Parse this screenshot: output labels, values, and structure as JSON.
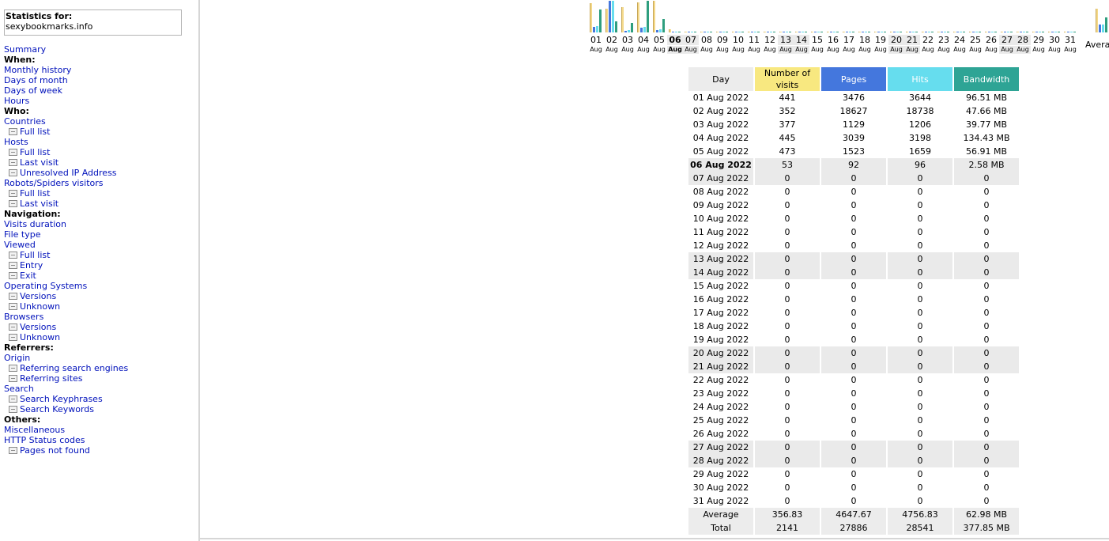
{
  "sidebar": {
    "stats_label": "Statistics for:",
    "site": "sexybookmarks.info",
    "items": [
      {
        "type": "link",
        "label": "Summary"
      },
      {
        "type": "head",
        "label": "When:"
      },
      {
        "type": "link",
        "label": "Monthly history"
      },
      {
        "type": "link",
        "label": "Days of month"
      },
      {
        "type": "link",
        "label": "Days of week"
      },
      {
        "type": "link",
        "label": "Hours"
      },
      {
        "type": "head",
        "label": "Who:"
      },
      {
        "type": "link",
        "label": "Countries"
      },
      {
        "type": "sub",
        "label": "Full list"
      },
      {
        "type": "link",
        "label": "Hosts"
      },
      {
        "type": "sub",
        "label": "Full list"
      },
      {
        "type": "sub",
        "label": "Last visit"
      },
      {
        "type": "sub",
        "label": "Unresolved IP Address"
      },
      {
        "type": "link",
        "label": "Robots/Spiders visitors"
      },
      {
        "type": "sub",
        "label": "Full list"
      },
      {
        "type": "sub",
        "label": "Last visit"
      },
      {
        "type": "head",
        "label": "Navigation:"
      },
      {
        "type": "link",
        "label": "Visits duration"
      },
      {
        "type": "link",
        "label": "File type"
      },
      {
        "type": "link",
        "label": "Viewed"
      },
      {
        "type": "sub",
        "label": "Full list"
      },
      {
        "type": "sub",
        "label": "Entry"
      },
      {
        "type": "sub",
        "label": "Exit"
      },
      {
        "type": "link",
        "label": "Operating Systems"
      },
      {
        "type": "sub",
        "label": "Versions"
      },
      {
        "type": "sub",
        "label": "Unknown"
      },
      {
        "type": "link",
        "label": "Browsers"
      },
      {
        "type": "sub",
        "label": "Versions"
      },
      {
        "type": "sub",
        "label": "Unknown"
      },
      {
        "type": "head",
        "label": "Referrers:"
      },
      {
        "type": "link",
        "label": "Origin"
      },
      {
        "type": "sub",
        "label": "Referring search engines"
      },
      {
        "type": "sub",
        "label": "Referring sites"
      },
      {
        "type": "link",
        "label": "Search"
      },
      {
        "type": "sub",
        "label": "Search Keyphrases"
      },
      {
        "type": "sub",
        "label": "Search Keywords"
      },
      {
        "type": "head",
        "label": "Others:"
      },
      {
        "type": "link",
        "label": "Miscellaneous"
      },
      {
        "type": "link",
        "label": "HTTP Status codes"
      },
      {
        "type": "sub",
        "label": "Pages not found"
      }
    ]
  },
  "colors": {
    "visits": "#f8e880",
    "pages": "#4477dd",
    "hits": "#66ddee",
    "bandwidth": "#2ea495",
    "link": "#0011bb"
  },
  "chart_data": {
    "type": "bar",
    "categories": [
      "01",
      "02",
      "03",
      "04",
      "05",
      "06",
      "07",
      "08",
      "09",
      "10",
      "11",
      "12",
      "13",
      "14",
      "15",
      "16",
      "17",
      "18",
      "19",
      "20",
      "21",
      "22",
      "23",
      "24",
      "25",
      "26",
      "27",
      "28",
      "29",
      "30",
      "31"
    ],
    "month_label": "Aug",
    "average_label": "Average",
    "series": [
      {
        "name": "Number of visits",
        "values": [
          441,
          352,
          377,
          445,
          473,
          53,
          0,
          0,
          0,
          0,
          0,
          0,
          0,
          0,
          0,
          0,
          0,
          0,
          0,
          0,
          0,
          0,
          0,
          0,
          0,
          0,
          0,
          0,
          0,
          0,
          0
        ]
      },
      {
        "name": "Pages",
        "values": [
          3476,
          18627,
          1129,
          3039,
          1523,
          92,
          0,
          0,
          0,
          0,
          0,
          0,
          0,
          0,
          0,
          0,
          0,
          0,
          0,
          0,
          0,
          0,
          0,
          0,
          0,
          0,
          0,
          0,
          0,
          0,
          0
        ]
      },
      {
        "name": "Hits",
        "values": [
          3644,
          18738,
          1206,
          3198,
          1659,
          96,
          0,
          0,
          0,
          0,
          0,
          0,
          0,
          0,
          0,
          0,
          0,
          0,
          0,
          0,
          0,
          0,
          0,
          0,
          0,
          0,
          0,
          0,
          0,
          0,
          0
        ]
      },
      {
        "name": "Bandwidth",
        "values": [
          96.51,
          47.66,
          39.77,
          134.43,
          56.91,
          2.58,
          0,
          0,
          0,
          0,
          0,
          0,
          0,
          0,
          0,
          0,
          0,
          0,
          0,
          0,
          0,
          0,
          0,
          0,
          0,
          0,
          0,
          0,
          0,
          0,
          0
        ]
      }
    ],
    "average": {
      "visits": 356.83,
      "pages": 4647.67,
      "hits": 4756.83,
      "bandwidth": 62.98
    },
    "weekend_days": [
      "06",
      "07",
      "13",
      "14",
      "20",
      "21",
      "27",
      "28"
    ],
    "current_day": "06"
  },
  "table": {
    "headers": [
      "Day",
      "Number of visits",
      "Pages",
      "Hits",
      "Bandwidth"
    ],
    "rows": [
      {
        "day": "01 Aug 2022",
        "visits": "441",
        "pages": "3476",
        "hits": "3644",
        "bw": "96.51 MB"
      },
      {
        "day": "02 Aug 2022",
        "visits": "352",
        "pages": "18627",
        "hits": "18738",
        "bw": "47.66 MB"
      },
      {
        "day": "03 Aug 2022",
        "visits": "377",
        "pages": "1129",
        "hits": "1206",
        "bw": "39.77 MB"
      },
      {
        "day": "04 Aug 2022",
        "visits": "445",
        "pages": "3039",
        "hits": "3198",
        "bw": "134.43 MB"
      },
      {
        "day": "05 Aug 2022",
        "visits": "473",
        "pages": "1523",
        "hits": "1659",
        "bw": "56.91 MB"
      },
      {
        "day": "06 Aug 2022",
        "visits": "53",
        "pages": "92",
        "hits": "96",
        "bw": "2.58 MB"
      },
      {
        "day": "07 Aug 2022",
        "visits": "0",
        "pages": "0",
        "hits": "0",
        "bw": "0"
      },
      {
        "day": "08 Aug 2022",
        "visits": "0",
        "pages": "0",
        "hits": "0",
        "bw": "0"
      },
      {
        "day": "09 Aug 2022",
        "visits": "0",
        "pages": "0",
        "hits": "0",
        "bw": "0"
      },
      {
        "day": "10 Aug 2022",
        "visits": "0",
        "pages": "0",
        "hits": "0",
        "bw": "0"
      },
      {
        "day": "11 Aug 2022",
        "visits": "0",
        "pages": "0",
        "hits": "0",
        "bw": "0"
      },
      {
        "day": "12 Aug 2022",
        "visits": "0",
        "pages": "0",
        "hits": "0",
        "bw": "0"
      },
      {
        "day": "13 Aug 2022",
        "visits": "0",
        "pages": "0",
        "hits": "0",
        "bw": "0"
      },
      {
        "day": "14 Aug 2022",
        "visits": "0",
        "pages": "0",
        "hits": "0",
        "bw": "0"
      },
      {
        "day": "15 Aug 2022",
        "visits": "0",
        "pages": "0",
        "hits": "0",
        "bw": "0"
      },
      {
        "day": "16 Aug 2022",
        "visits": "0",
        "pages": "0",
        "hits": "0",
        "bw": "0"
      },
      {
        "day": "17 Aug 2022",
        "visits": "0",
        "pages": "0",
        "hits": "0",
        "bw": "0"
      },
      {
        "day": "18 Aug 2022",
        "visits": "0",
        "pages": "0",
        "hits": "0",
        "bw": "0"
      },
      {
        "day": "19 Aug 2022",
        "visits": "0",
        "pages": "0",
        "hits": "0",
        "bw": "0"
      },
      {
        "day": "20 Aug 2022",
        "visits": "0",
        "pages": "0",
        "hits": "0",
        "bw": "0"
      },
      {
        "day": "21 Aug 2022",
        "visits": "0",
        "pages": "0",
        "hits": "0",
        "bw": "0"
      },
      {
        "day": "22 Aug 2022",
        "visits": "0",
        "pages": "0",
        "hits": "0",
        "bw": "0"
      },
      {
        "day": "23 Aug 2022",
        "visits": "0",
        "pages": "0",
        "hits": "0",
        "bw": "0"
      },
      {
        "day": "24 Aug 2022",
        "visits": "0",
        "pages": "0",
        "hits": "0",
        "bw": "0"
      },
      {
        "day": "25 Aug 2022",
        "visits": "0",
        "pages": "0",
        "hits": "0",
        "bw": "0"
      },
      {
        "day": "26 Aug 2022",
        "visits": "0",
        "pages": "0",
        "hits": "0",
        "bw": "0"
      },
      {
        "day": "27 Aug 2022",
        "visits": "0",
        "pages": "0",
        "hits": "0",
        "bw": "0"
      },
      {
        "day": "28 Aug 2022",
        "visits": "0",
        "pages": "0",
        "hits": "0",
        "bw": "0"
      },
      {
        "day": "29 Aug 2022",
        "visits": "0",
        "pages": "0",
        "hits": "0",
        "bw": "0"
      },
      {
        "day": "30 Aug 2022",
        "visits": "0",
        "pages": "0",
        "hits": "0",
        "bw": "0"
      },
      {
        "day": "31 Aug 2022",
        "visits": "0",
        "pages": "0",
        "hits": "0",
        "bw": "0"
      }
    ],
    "average": {
      "day": "Average",
      "visits": "356.83",
      "pages": "4647.67",
      "hits": "4756.83",
      "bw": "62.98 MB"
    },
    "total": {
      "day": "Total",
      "visits": "2141",
      "pages": "27886",
      "hits": "28541",
      "bw": "377.85 MB"
    }
  }
}
